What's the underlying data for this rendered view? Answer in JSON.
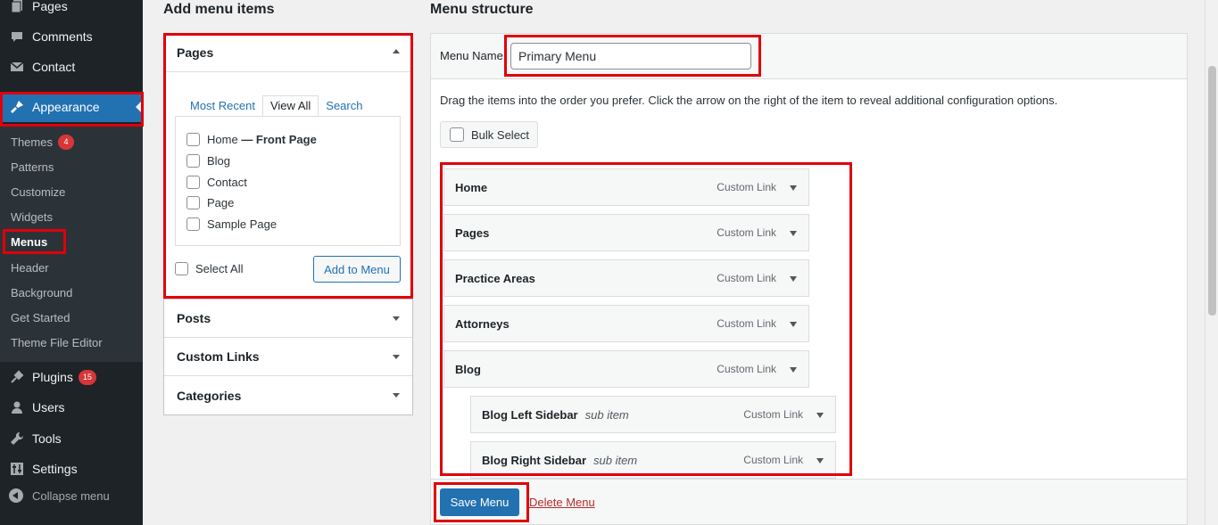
{
  "sidebar": {
    "top_items": [
      {
        "label": "Pages",
        "icon": "pages-icon"
      },
      {
        "label": "Comments",
        "icon": "comments-icon"
      },
      {
        "label": "Contact",
        "icon": "mail-icon"
      },
      {
        "label": "Appearance",
        "icon": "brush-icon"
      }
    ],
    "sub_items": [
      {
        "label": "Themes",
        "badge": "4"
      },
      {
        "label": "Patterns"
      },
      {
        "label": "Customize"
      },
      {
        "label": "Widgets"
      },
      {
        "label": "Menus"
      },
      {
        "label": "Header"
      },
      {
        "label": "Background"
      },
      {
        "label": "Get Started"
      },
      {
        "label": "Theme File Editor"
      }
    ],
    "bottom_items": [
      {
        "label": "Plugins",
        "icon": "plugins-icon",
        "badge": "15"
      },
      {
        "label": "Users",
        "icon": "users-icon"
      },
      {
        "label": "Tools",
        "icon": "tools-icon"
      },
      {
        "label": "Settings",
        "icon": "settings-icon"
      }
    ],
    "collapse_label": "Collapse menu"
  },
  "add_items": {
    "heading": "Add menu items",
    "pages": {
      "title": "Pages",
      "tabs": [
        "Most Recent",
        "View All",
        "Search"
      ],
      "active_tab": "View All",
      "items": [
        {
          "label": "Home",
          "suffix": "— Front Page"
        },
        {
          "label": "Blog"
        },
        {
          "label": "Contact"
        },
        {
          "label": "Page"
        },
        {
          "label": "Sample Page"
        }
      ],
      "select_all": "Select All",
      "add_button": "Add to Menu"
    },
    "sections": [
      "Posts",
      "Custom Links",
      "Categories"
    ]
  },
  "structure": {
    "heading": "Menu structure",
    "menu_name_label": "Menu Name",
    "menu_name_value": "Primary Menu",
    "instructions": "Drag the items into the order you prefer. Click the arrow on the right of the item to reveal additional configuration options.",
    "bulk_select": "Bulk Select",
    "items": [
      {
        "title": "Home",
        "type": "Custom Link"
      },
      {
        "title": "Pages",
        "type": "Custom Link"
      },
      {
        "title": "Practice Areas",
        "type": "Custom Link"
      },
      {
        "title": "Attorneys",
        "type": "Custom Link"
      },
      {
        "title": "Blog",
        "type": "Custom Link"
      },
      {
        "title": "Blog Left Sidebar",
        "sub": "sub item",
        "type": "Custom Link"
      },
      {
        "title": "Blog Right Sidebar",
        "sub": "sub item",
        "type": "Custom Link"
      }
    ],
    "save_button": "Save Menu",
    "delete_link": "Delete Menu"
  },
  "colors": {
    "highlight": "#e0000b",
    "accent": "#2271b1",
    "sidebar_bg": "#1d2327"
  }
}
